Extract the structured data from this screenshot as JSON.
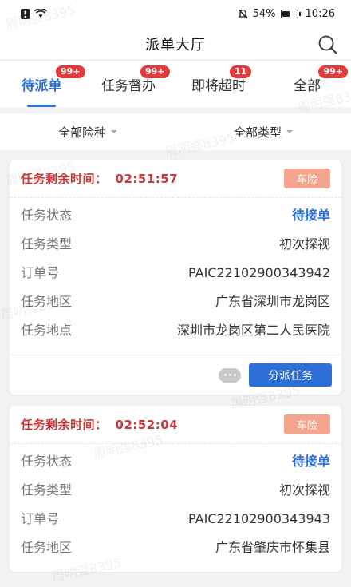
{
  "status_bar": {
    "battery": "54%",
    "time": "10:26",
    "battery_level": 0.54
  },
  "header": {
    "title": "派单大厅"
  },
  "tabs": [
    {
      "label": "待派单",
      "badge": "99+",
      "active": true
    },
    {
      "label": "任务督办",
      "badge": "99+",
      "active": false
    },
    {
      "label": "即将超时",
      "badge": "11",
      "active": false
    },
    {
      "label": "全部",
      "badge": "99+",
      "active": false
    }
  ],
  "filters": {
    "insurance": "全部险种",
    "type": "全部类型"
  },
  "cards": [
    {
      "countdown_label": "任务剩余时间：",
      "countdown": "02:51:57",
      "tag": "车险",
      "rows": [
        {
          "k": "任务状态",
          "v": "待接单"
        },
        {
          "k": "任务类型",
          "v": "初次探视"
        },
        {
          "k": "订单号",
          "v": "PAIC22102900343942"
        },
        {
          "k": "任务地区",
          "v": "广东省深圳市龙岗区"
        },
        {
          "k": "任务地点",
          "v": "深圳市龙岗区第二人民医院"
        }
      ],
      "action": "分派任务"
    },
    {
      "countdown_label": "任务剩余时间：",
      "countdown": "02:52:04",
      "tag": "车险",
      "rows": [
        {
          "k": "任务状态",
          "v": "待接单"
        },
        {
          "k": "任务类型",
          "v": "初次探视"
        },
        {
          "k": "订单号",
          "v": "PAIC22102900343943"
        },
        {
          "k": "任务地区",
          "v": "广东省肇庆市怀集县"
        }
      ]
    }
  ],
  "watermark": "周明强8395",
  "colors": {
    "accent": "#2c6fd6",
    "badge": "#e33b3b",
    "countdown": "#c9393a",
    "tag": "#f4a58e"
  }
}
